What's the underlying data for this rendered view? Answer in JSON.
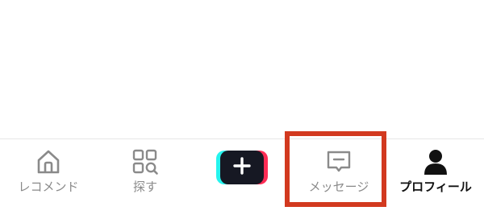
{
  "tab_bar": {
    "tabs": [
      {
        "id": "home",
        "label": "レコメンド",
        "icon": "home-icon"
      },
      {
        "id": "discover",
        "label": "探す",
        "icon": "grid-search-icon"
      },
      {
        "id": "create",
        "label": "",
        "icon": "plus-icon"
      },
      {
        "id": "inbox",
        "label": "メッセージ",
        "icon": "message-icon"
      },
      {
        "id": "profile",
        "label": "プロフィール",
        "icon": "person-icon",
        "active": true
      }
    ]
  },
  "colors": {
    "inactive": "#8a8a8a",
    "active": "#111111",
    "create_main": "#161823",
    "create_cyan": "#25f4ee",
    "create_red": "#fe2c55",
    "highlight": "#d2391f"
  }
}
